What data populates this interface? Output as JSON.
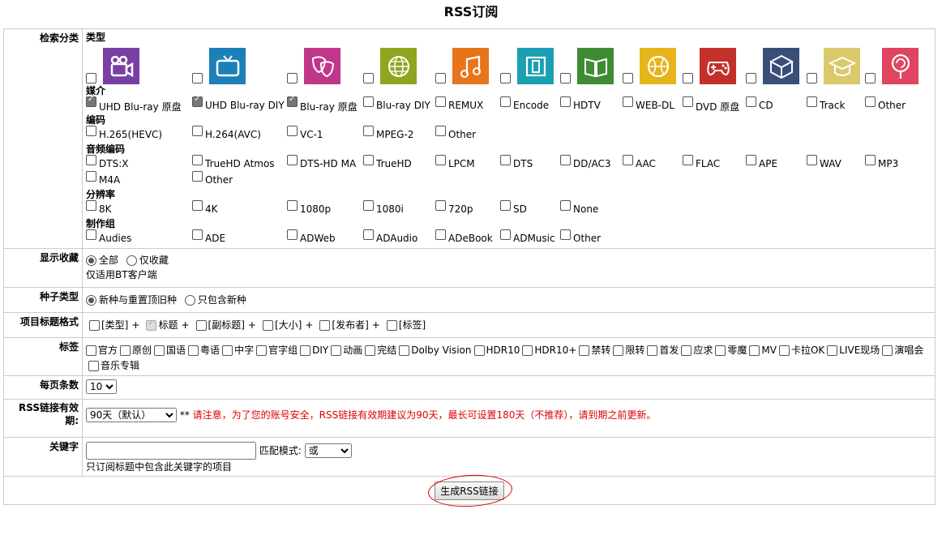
{
  "title": "RSS订阅",
  "filters": {
    "label": "检索分类",
    "categories_title": "类型",
    "categories": [
      {
        "icon": "camera-movie-icon",
        "color": "#7a3fa3"
      },
      {
        "icon": "tv-icon",
        "color": "#1c7fb8"
      },
      {
        "icon": "theater-masks-icon",
        "color": "#c0378a"
      },
      {
        "icon": "globe-documentary-icon",
        "color": "#8ea61e"
      },
      {
        "icon": "music-note-icon",
        "color": "#e8741a"
      },
      {
        "icon": "stage-performance-icon",
        "color": "#1aa0b2"
      },
      {
        "icon": "open-book-icon",
        "color": "#3f8b33"
      },
      {
        "icon": "basketball-icon",
        "color": "#e6b41b"
      },
      {
        "icon": "gamepad-icon",
        "color": "#c3312c"
      },
      {
        "icon": "box-software-icon",
        "color": "#3a4e7a"
      },
      {
        "icon": "graduation-cap-icon",
        "color": "#d9c96a"
      },
      {
        "icon": "lollipop-icon",
        "color": "#e0455f"
      }
    ],
    "medium": {
      "title": "媒介",
      "options": [
        {
          "label": "UHD Blu-ray 原盘",
          "checked": true
        },
        {
          "label": "UHD Blu-ray DIY",
          "checked": true
        },
        {
          "label": "Blu-ray 原盘",
          "checked": true
        },
        {
          "label": "Blu-ray DIY"
        },
        {
          "label": "REMUX"
        },
        {
          "label": "Encode"
        },
        {
          "label": "HDTV"
        },
        {
          "label": "WEB-DL"
        },
        {
          "label": "DVD 原盘"
        },
        {
          "label": "CD"
        },
        {
          "label": "Track"
        },
        {
          "label": "Other"
        }
      ]
    },
    "codec": {
      "title": "编码",
      "options": [
        {
          "label": "H.265(HEVC)"
        },
        {
          "label": "H.264(AVC)"
        },
        {
          "label": "VC-1"
        },
        {
          "label": "MPEG-2"
        },
        {
          "label": "Other"
        }
      ]
    },
    "audio": {
      "title": "音频编码",
      "options": [
        {
          "label": "DTS:X"
        },
        {
          "label": "TrueHD Atmos"
        },
        {
          "label": "DTS-HD MA"
        },
        {
          "label": "TrueHD"
        },
        {
          "label": "LPCM"
        },
        {
          "label": "DTS"
        },
        {
          "label": "DD/AC3"
        },
        {
          "label": "AAC"
        },
        {
          "label": "FLAC"
        },
        {
          "label": "APE"
        },
        {
          "label": "WAV"
        },
        {
          "label": "MP3"
        },
        {
          "label": "M4A"
        },
        {
          "label": "Other"
        }
      ]
    },
    "resolution": {
      "title": "分辨率",
      "options": [
        {
          "label": "8K"
        },
        {
          "label": "4K"
        },
        {
          "label": "1080p"
        },
        {
          "label": "1080i"
        },
        {
          "label": "720p"
        },
        {
          "label": "SD"
        },
        {
          "label": " None"
        }
      ]
    },
    "group": {
      "title": "制作组",
      "options": [
        {
          "label": "Audies"
        },
        {
          "label": "ADE"
        },
        {
          "label": "ADWeb"
        },
        {
          "label": "ADAudio"
        },
        {
          "label": "ADeBook"
        },
        {
          "label": "ADMusic"
        },
        {
          "label": "Other"
        }
      ]
    }
  },
  "bookmark": {
    "label": "显示收藏",
    "opt_all": "全部",
    "opt_fav": "仅收藏",
    "note": "仅适用BT客户端"
  },
  "torrent_type": {
    "label": "种子类型",
    "opt1": "新种与重置顶旧种",
    "opt2": "只包含新种"
  },
  "title_format": {
    "label": "项目标题格式",
    "items": [
      "[类型]",
      "标题",
      "[副标题]",
      "[大小]",
      "[发布者]",
      "[标签]"
    ],
    "sep": "+"
  },
  "tags": {
    "label": "标签",
    "items": [
      "官方",
      "原创",
      "国语",
      "粤语",
      "中字",
      "官字组",
      "DIY",
      "动画",
      "完结",
      "Dolby Vision",
      "HDR10",
      "HDR10+",
      "禁转",
      "限转",
      "首发",
      "应求",
      "零魔",
      "MV",
      "卡拉OK",
      "LIVE现场",
      "演唱会",
      "音乐专辑"
    ]
  },
  "per_page": {
    "label": "每页条数",
    "value": "10"
  },
  "rss_expiry": {
    "label_a": "RSS链接有效",
    "label_b": "期:",
    "value": "90天（默认）",
    "stars": "**",
    "notice": "请注意，为了您的账号安全，RSS链接有效期建议为90天，最长可设置180天（不推荐），请到期之前更新。"
  },
  "keyword": {
    "label": "关键字",
    "input_value": "",
    "match_label": "匹配模式:",
    "match_value": "或",
    "note": "只订阅标题中包含此关键字的项目"
  },
  "submit_label": "生成RSS链接"
}
